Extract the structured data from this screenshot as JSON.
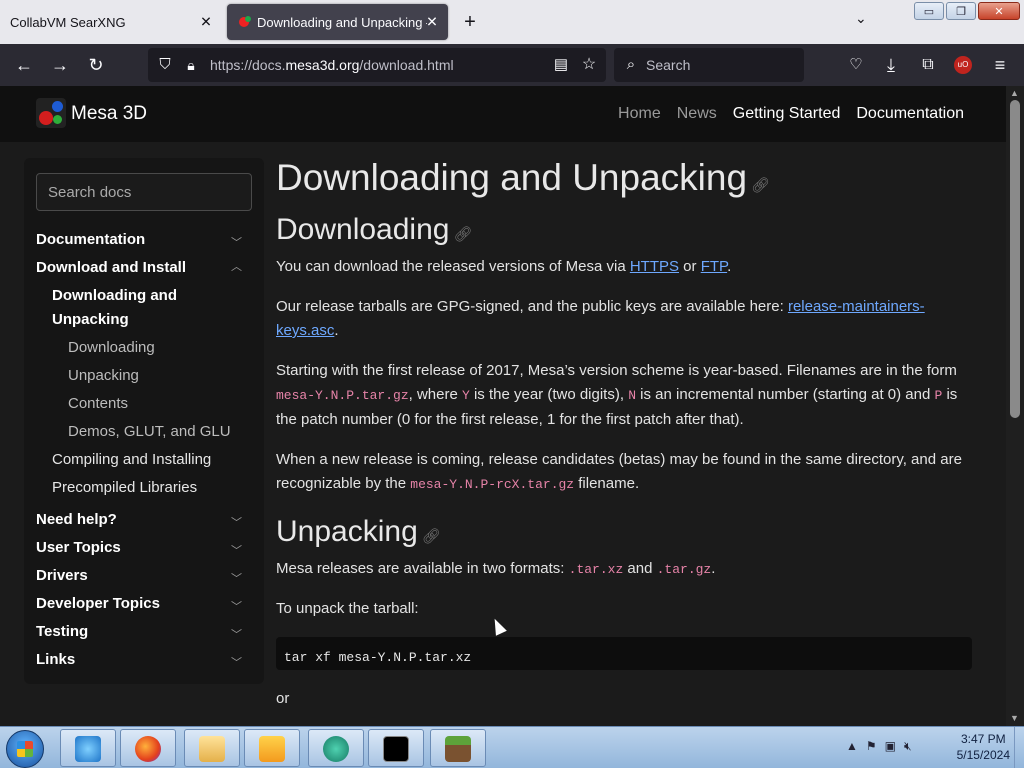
{
  "browser": {
    "tabs": [
      {
        "title": "CollabVM SearXNG",
        "close": "✕"
      },
      {
        "title": "Downloading and Unpacking — ",
        "close": "✕"
      }
    ],
    "new_tab": "+",
    "tab_list": "⌄",
    "url_prefix": "https://docs.",
    "url_domain": "mesa3d.org",
    "url_path": "/download.html",
    "search_placeholder": "Search",
    "window_controls": {
      "minimize": "▭",
      "restore": "❐",
      "close": "✕"
    }
  },
  "site": {
    "brand": "Mesa 3D",
    "nav": [
      "Home",
      "News",
      "Getting Started",
      "Documentation"
    ]
  },
  "sidebar": {
    "search_placeholder": "Search docs",
    "items": [
      {
        "label": "Documentation"
      },
      {
        "label": "Download and Install"
      },
      {
        "label": "Downloading and"
      },
      {
        "label": "Unpacking"
      },
      {
        "label": "Downloading"
      },
      {
        "label": "Unpacking"
      },
      {
        "label": "Contents"
      },
      {
        "label": "Demos, GLUT, and GLU"
      },
      {
        "label": "Compiling and Installing"
      },
      {
        "label": "Precompiled Libraries"
      },
      {
        "label": "Need help?"
      },
      {
        "label": "User Topics"
      },
      {
        "label": "Drivers"
      },
      {
        "label": "Developer Topics"
      },
      {
        "label": "Testing"
      },
      {
        "label": "Links"
      }
    ]
  },
  "content": {
    "h1": "Downloading and Unpacking",
    "h2_downloading": "Downloading",
    "p1_text": "You can download the released versions of Mesa via ",
    "p1_link1": "HTTPS",
    "p1_or": " or ",
    "p1_link2": "FTP",
    "p1_end": ".",
    "p2_text": "Our release tarballs are GPG-signed, and the public keys are available here: ",
    "p2_link": "release-maintainers-keys.asc",
    "p2_end": ".",
    "p3_a": "Starting with the first release of 2017, Mesa’s version scheme is year-based. Filenames are in the form ",
    "p3_code1": "mesa-Y.N.P.tar.gz",
    "p3_b": ", where ",
    "p3_code2": "Y",
    "p3_c": " is the year (two digits), ",
    "p3_code3": "N",
    "p3_d": " is an incremental number (starting at 0) and ",
    "p3_code4": "P",
    "p3_e": " is the patch number (0 for the first release, 1 for the first patch after that).",
    "p4_a": "When a new release is coming, release candidates (betas) may be found in the same directory, and are recognizable by the ",
    "p4_code": "mesa-Y.N.P-rcX.tar.gz",
    "p4_b": " filename.",
    "h2_unpacking": "Unpacking",
    "p5_a": "Mesa releases are available in two formats: ",
    "p5_code1": ".tar.xz",
    "p5_b": " and ",
    "p5_code2": ".tar.gz",
    "p5_c": ".",
    "p6": "To unpack the tarball:",
    "code_block": "tar xf mesa-Y.N.P.tar.xz",
    "p7": "or"
  },
  "taskbar": {
    "time": "3:47 PM",
    "date": "5/15/2024"
  }
}
